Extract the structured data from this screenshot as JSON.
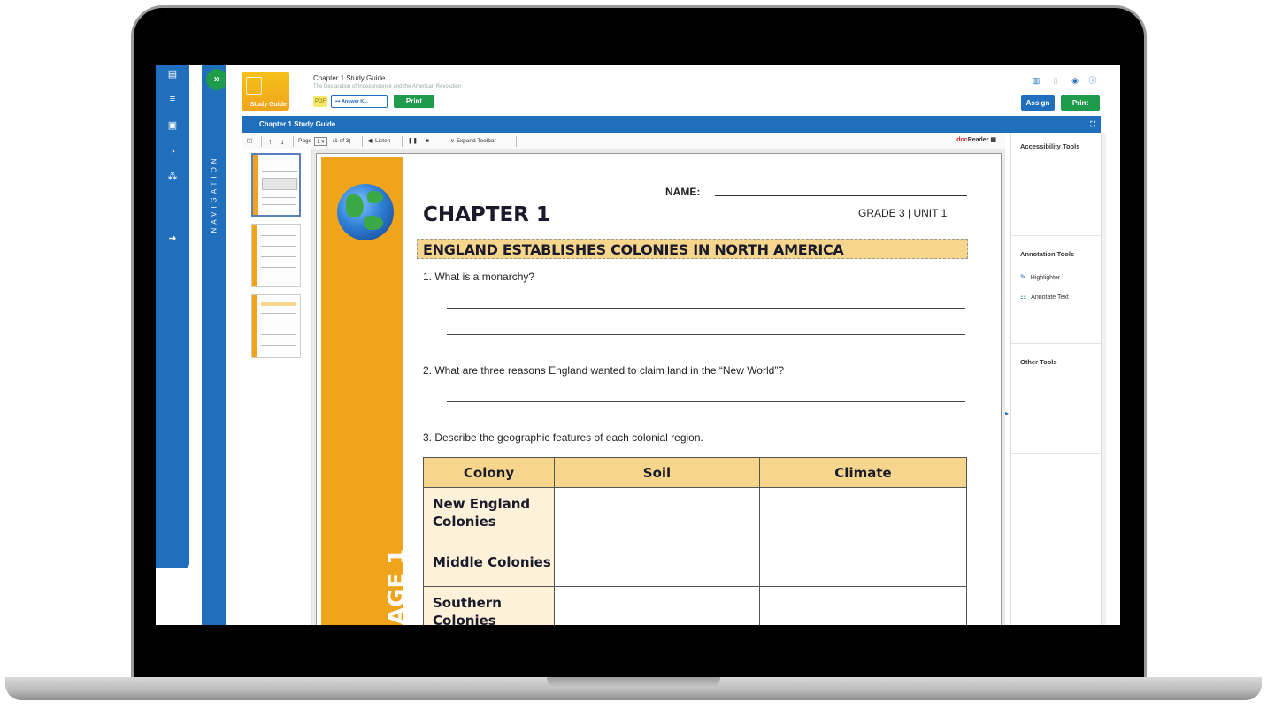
{
  "header": {
    "title": "Chapter 1 Study Guide",
    "subtitle": "The Declaration of Independence and the American Revolution",
    "logo_text": "Study Guide",
    "pdf_label": "PDF",
    "answer_key_label": "Answer K...",
    "print_label": "Print",
    "assign_label": "Assign",
    "print_right_label": "Print"
  },
  "nav": {
    "label": "NAVIGATION",
    "toggle_icon": "»"
  },
  "titlebar": {
    "title": "Chapter 1 Study Guide"
  },
  "toolbar": {
    "page_label": "Page",
    "page_value": "1",
    "page_of": "(1 of 3)",
    "listen_label": "Listen",
    "expand_label": "Expand Toolbar",
    "brand_doc": "doc",
    "brand_reader": "Reader"
  },
  "document": {
    "name_label": "NAME:",
    "chapter": "CHAPTER 1",
    "grade_unit": "GRADE 3 | UNIT 1",
    "banner": "ENGLAND ESTABLISHES COLONIES IN NORTH AMERICA",
    "q1": "1.  What is a monarchy?",
    "q2": "2.  What are three reasons England wanted to claim land in the “New World”?",
    "q3": "3.  Describe the geographic features of each colonial region.",
    "side_text": "AGE 1",
    "table": {
      "headers": [
        "Colony",
        "Soil",
        "Climate"
      ],
      "rows": [
        "New England Colonies",
        "Middle Colonies",
        "Southern Colonies"
      ]
    }
  },
  "right_panel": {
    "accessibility": "Accessibility Tools",
    "annotation": "Annotation Tools",
    "highlighter": "Highlighter",
    "annotate_text": "Annotate Text",
    "other": "Other Tools"
  },
  "colors": {
    "brand_blue": "#1f6fbd",
    "brand_green": "#1e9b4b",
    "accent_orange": "#f0a41b",
    "banner_tan": "#f6d68c"
  }
}
